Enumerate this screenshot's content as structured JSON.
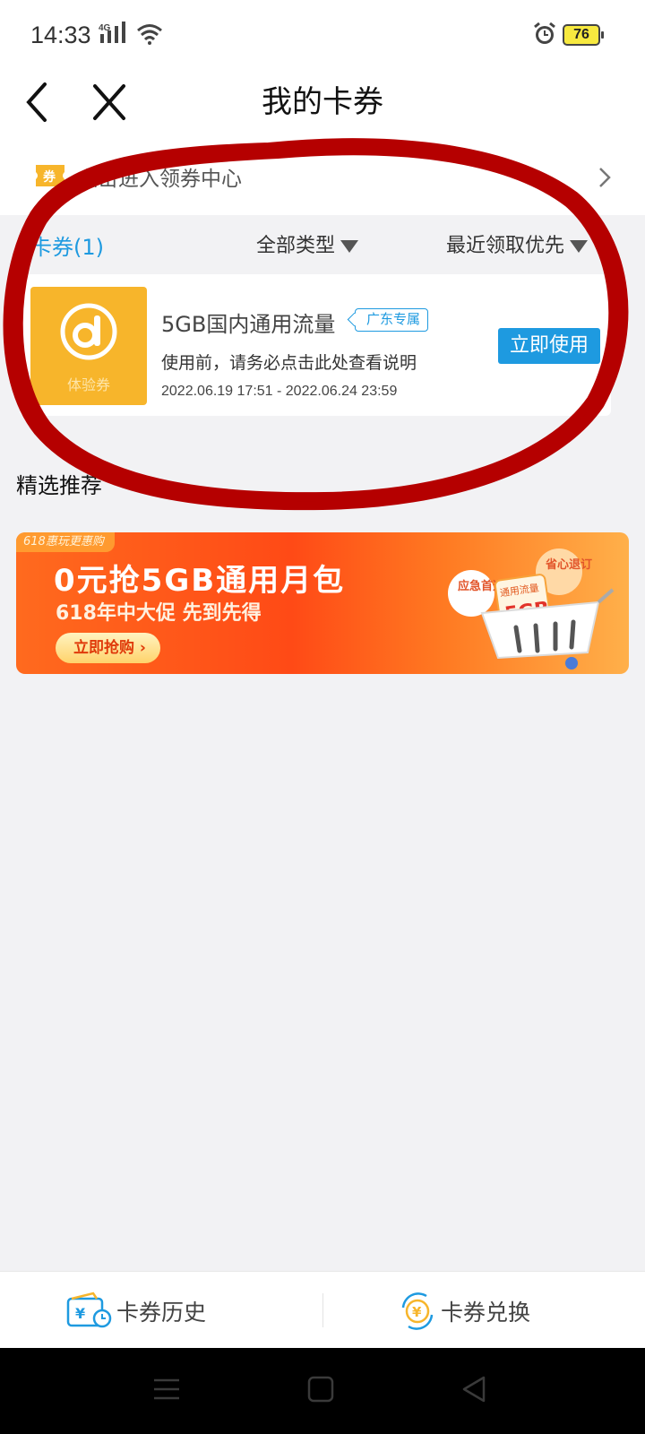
{
  "status_bar": {
    "time": "14:33",
    "network": "4G",
    "battery": "76"
  },
  "nav": {
    "title": "我的卡券",
    "back_icon": "back-arrow-icon",
    "close_icon": "close-icon"
  },
  "coupon_center": {
    "badge": "券",
    "text": "点击进入领券中心"
  },
  "filters": {
    "count_label": "卡券(1)",
    "type_label": "全部类型",
    "sort_label": "最近领取优先"
  },
  "coupon": {
    "logo_label": "体验券",
    "name": "5GB国内通用流量",
    "tag": "广东专属",
    "description": "使用前，请务必点击此处查看说明",
    "validity": "2022.06.19 17:51 - 2022.06.24 23:59",
    "action_label": "立即使用"
  },
  "recommend": {
    "title": "精选推荐",
    "banner": {
      "badge": "618惠玩更惠购",
      "headline": "0元抢5GB通用月包",
      "subline": "618年中大促 先到先得",
      "cta": "立即抢购",
      "art_labels": {
        "bubble_left": "应急首选",
        "bubble_right": "省心退订",
        "card_title": "通用流量",
        "card_value": "5GB"
      }
    }
  },
  "bottom_bar": {
    "history_label": "卡券历史",
    "exchange_label": "卡券兑换"
  },
  "colors": {
    "accent_blue": "#1e9ae0",
    "coupon_yellow": "#f7b52b",
    "annotation_red": "#b50000",
    "banner_orange": "#ff5a1a"
  }
}
